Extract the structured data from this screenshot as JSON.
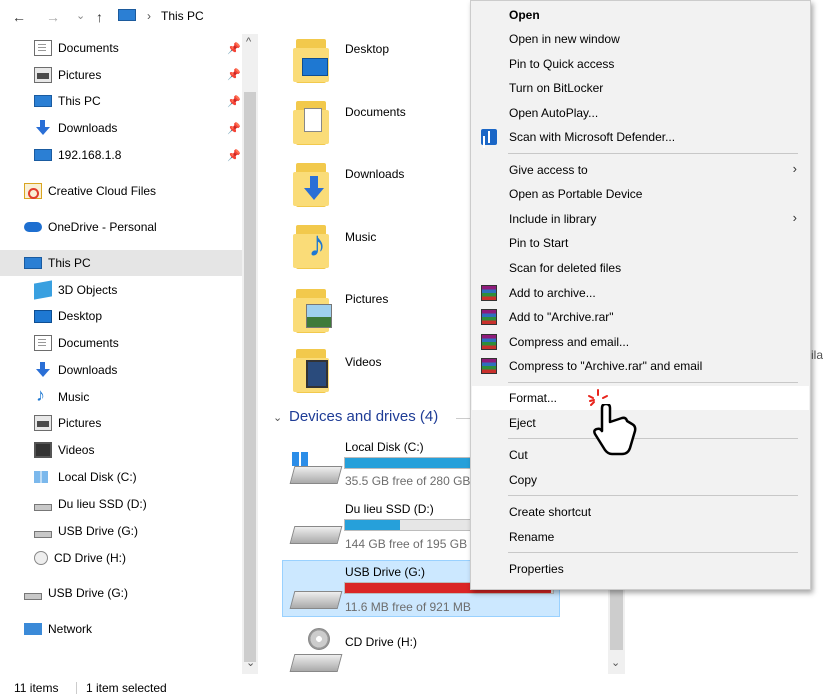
{
  "address": {
    "back_glyph": "←",
    "forward_glyph": "→",
    "recent_glyph": "⌄",
    "up_glyph": "↑",
    "separator_glyph": "›",
    "path": "This PC"
  },
  "sidebar": {
    "items": [
      {
        "label": "Documents",
        "icon": "document-icon",
        "pinned": true
      },
      {
        "label": "Pictures",
        "icon": "pictures-icon",
        "pinned": true
      },
      {
        "label": "This PC",
        "icon": "computer-icon",
        "pinned": true
      },
      {
        "label": "Downloads",
        "icon": "download-icon",
        "pinned": true
      },
      {
        "label": "192.168.1.8",
        "icon": "network-drive-icon",
        "pinned": true
      },
      {
        "label": "Creative Cloud Files",
        "icon": "creative-cloud-icon"
      },
      {
        "label": "OneDrive - Personal",
        "icon": "onedrive-icon"
      },
      {
        "label": "This PC",
        "icon": "computer-icon",
        "selected": true
      },
      {
        "label": "3D Objects",
        "icon": "3d-objects-icon"
      },
      {
        "label": "Desktop",
        "icon": "desktop-icon"
      },
      {
        "label": "Documents",
        "icon": "document-icon"
      },
      {
        "label": "Downloads",
        "icon": "download-icon"
      },
      {
        "label": "Music",
        "icon": "music-icon"
      },
      {
        "label": "Pictures",
        "icon": "pictures-icon"
      },
      {
        "label": "Videos",
        "icon": "videos-icon"
      },
      {
        "label": "Local Disk (C:)",
        "icon": "local-disk-icon"
      },
      {
        "label": "Du lieu SSD (D:)",
        "icon": "drive-icon"
      },
      {
        "label": "USB Drive (G:)",
        "icon": "drive-icon"
      },
      {
        "label": "CD Drive (H:)",
        "icon": "cd-drive-icon"
      },
      {
        "label": "USB Drive (G:)",
        "icon": "drive-icon"
      },
      {
        "label": "Network",
        "icon": "network-icon"
      }
    ],
    "pin_glyph": "📌",
    "scroll_up_glyph": "^",
    "scroll_down_glyph": "⌄"
  },
  "content": {
    "folders": [
      {
        "label": "Desktop",
        "icon": "desktop-folder-icon"
      },
      {
        "label": "Documents",
        "icon": "documents-folder-icon"
      },
      {
        "label": "Downloads",
        "icon": "downloads-folder-icon"
      },
      {
        "label": "Music",
        "icon": "music-folder-icon"
      },
      {
        "label": "Pictures",
        "icon": "pictures-folder-icon"
      },
      {
        "label": "Videos",
        "icon": "videos-folder-icon"
      }
    ],
    "group_header": "Devices and drives (4)",
    "group_chevron": "⌄",
    "drives": [
      {
        "label": "Local Disk (C:)",
        "free_text": "35.5 GB free of 280 GB",
        "used_fraction": 0.87,
        "bar_color": "#26a0da"
      },
      {
        "label": "Du lieu SSD (D:)",
        "free_text": "144 GB free of 195 GB",
        "used_fraction": 0.26,
        "bar_color": "#26a0da"
      },
      {
        "label": "USB Drive (G:)",
        "free_text": "11.6 MB free of 921 MB",
        "used_fraction": 0.99,
        "bar_color": "#da2626",
        "selected": true
      },
      {
        "label": "CD Drive (H:)",
        "free_text": ""
      }
    ],
    "right_fragment": "ila"
  },
  "status": {
    "items_count": "11 items",
    "selection": "1 item selected"
  },
  "context_menu": {
    "items": [
      {
        "label": "Open",
        "bold": true
      },
      {
        "label": "Open in new window"
      },
      {
        "label": "Pin to Quick access"
      },
      {
        "label": "Turn on BitLocker"
      },
      {
        "label": "Open AutoPlay..."
      },
      {
        "label": "Scan with Microsoft Defender...",
        "icon": "defender-icon"
      },
      {
        "separator": true
      },
      {
        "label": "Give access to",
        "submenu": true
      },
      {
        "label": "Open as Portable Device"
      },
      {
        "label": "Include in library",
        "submenu": true
      },
      {
        "label": "Pin to Start"
      },
      {
        "label": "Scan for deleted files"
      },
      {
        "label": "Add to archive...",
        "icon": "winrar-icon"
      },
      {
        "label": "Add to \"Archive.rar\"",
        "icon": "winrar-icon"
      },
      {
        "label": "Compress and email...",
        "icon": "winrar-icon"
      },
      {
        "label": "Compress to \"Archive.rar\" and email",
        "icon": "winrar-icon"
      },
      {
        "separator": true
      },
      {
        "label": "Format...",
        "hover": true
      },
      {
        "label": "Eject"
      },
      {
        "separator": true
      },
      {
        "label": "Cut"
      },
      {
        "label": "Copy"
      },
      {
        "separator": true
      },
      {
        "label": "Create shortcut"
      },
      {
        "label": "Rename"
      },
      {
        "separator": true
      },
      {
        "label": "Properties"
      }
    ],
    "submenu_glyph": "›"
  },
  "colors": {
    "selection_bg": "#cce8ff",
    "accent_blue": "#26a0da",
    "warning_red": "#da2626",
    "group_header": "#1e3c96"
  }
}
